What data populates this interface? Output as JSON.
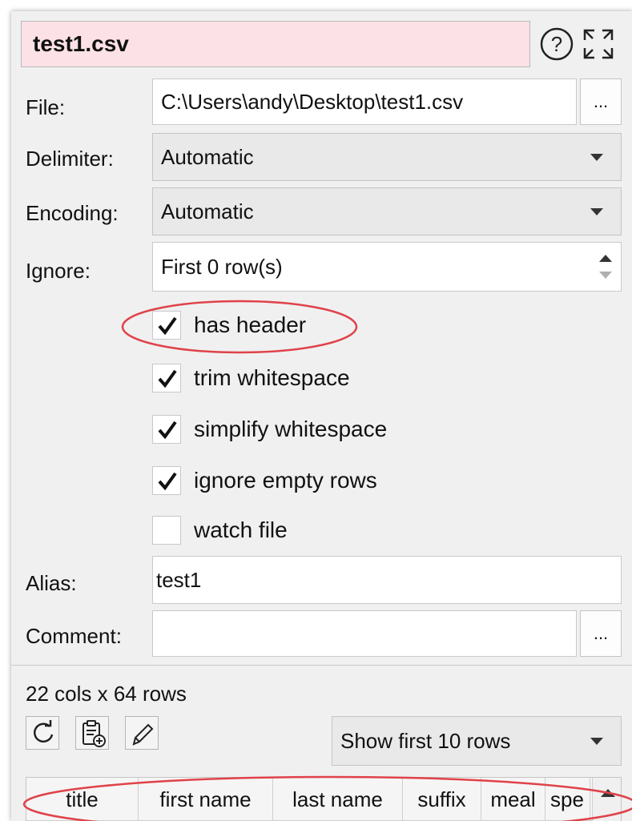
{
  "window": {
    "title": "test1.csv"
  },
  "header_icons": {
    "help": "help-circle-icon",
    "maximize": "maximize-arrows-icon"
  },
  "form": {
    "file_label": "File:",
    "file_value": "C:\\Users\\andy\\Desktop\\test1.csv",
    "browse_label": "...",
    "delimiter_label": "Delimiter:",
    "delimiter_value": "Automatic",
    "encoding_label": "Encoding:",
    "encoding_value": "Automatic",
    "ignore_label": "Ignore:",
    "ignore_value": "First 0 row(s)",
    "options": [
      {
        "label": "has header",
        "checked": true
      },
      {
        "label": "trim whitespace",
        "checked": true
      },
      {
        "label": "simplify whitespace",
        "checked": true
      },
      {
        "label": "ignore empty rows",
        "checked": true
      },
      {
        "label": "watch file",
        "checked": false
      }
    ],
    "alias_label": "Alias:",
    "alias_value": "test1",
    "comment_label": "Comment:",
    "comment_value": "",
    "comment_more": "..."
  },
  "summary": {
    "dimensions": "22 cols x 64 rows"
  },
  "toolbar": {
    "refresh_icon": "refresh-icon",
    "clipboard_icon": "clipboard-icon",
    "edit_icon": "pencil-icon",
    "show_rows_value": "Show first 10 rows"
  },
  "table": {
    "columns": [
      "title",
      "first name",
      "last name",
      "suffix",
      "meal",
      "spe"
    ]
  },
  "colors": {
    "title_bg": "#fce1e6",
    "highlight_ellipse": "#e0424a",
    "panel_bg": "#f0f0f0"
  }
}
